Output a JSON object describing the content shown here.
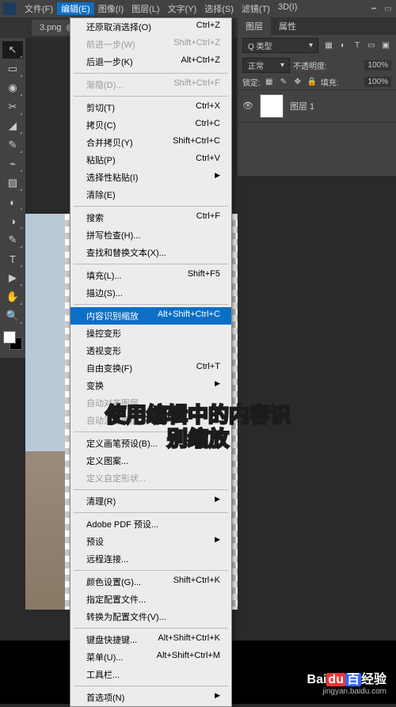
{
  "menubar": {
    "items": [
      "文件(F)",
      "编辑(E)",
      "图像(I)",
      "图层(L)",
      "文字(Y)",
      "选择(S)",
      "滤镜(T)",
      "3D(I)"
    ],
    "active_index": 1
  },
  "document_tab": {
    "title": "3.png",
    "meta": "@"
  },
  "panels": {
    "tabs": [
      "图层",
      "属性"
    ],
    "kind_label": "Q 类型",
    "blend_mode": "正常",
    "opacity_label": "不透明度:",
    "opacity_value": "100%",
    "lock_label": "锁定:",
    "fill_label": "填充:",
    "fill_value": "100%",
    "layer_name": "图层 1"
  },
  "edit_menu": [
    {
      "label": "还原取消选择(O)",
      "shortcut": "Ctrl+Z"
    },
    {
      "label": "前进一步(W)",
      "shortcut": "Shift+Ctrl+Z",
      "disabled": true
    },
    {
      "label": "后退一步(K)",
      "shortcut": "Alt+Ctrl+Z"
    },
    {
      "sep": true
    },
    {
      "label": "渐隐(D)...",
      "shortcut": "Shift+Ctrl+F",
      "disabled": true
    },
    {
      "sep": true
    },
    {
      "label": "剪切(T)",
      "shortcut": "Ctrl+X"
    },
    {
      "label": "拷贝(C)",
      "shortcut": "Ctrl+C"
    },
    {
      "label": "合并拷贝(Y)",
      "shortcut": "Shift+Ctrl+C"
    },
    {
      "label": "粘贴(P)",
      "shortcut": "Ctrl+V"
    },
    {
      "label": "选择性粘贴(I)",
      "submenu": true
    },
    {
      "label": "清除(E)"
    },
    {
      "sep": true
    },
    {
      "label": "搜索",
      "shortcut": "Ctrl+F"
    },
    {
      "label": "拼写检查(H)..."
    },
    {
      "label": "查找和替换文本(X)..."
    },
    {
      "sep": true
    },
    {
      "label": "填充(L)...",
      "shortcut": "Shift+F5"
    },
    {
      "label": "描边(S)..."
    },
    {
      "sep": true
    },
    {
      "label": "内容识别缩放",
      "shortcut": "Alt+Shift+Ctrl+C",
      "highlighted": true
    },
    {
      "label": "操控变形"
    },
    {
      "label": "透视变形"
    },
    {
      "label": "自由变换(F)",
      "shortcut": "Ctrl+T"
    },
    {
      "label": "变换",
      "submenu": true
    },
    {
      "label": "自动对齐图层...",
      "disabled": true
    },
    {
      "label": "自动混合图层...",
      "disabled": true
    },
    {
      "sep": true
    },
    {
      "label": "定义画笔预设(B)..."
    },
    {
      "label": "定义图案..."
    },
    {
      "label": "定义自定形状...",
      "disabled": true
    },
    {
      "sep": true
    },
    {
      "label": "清理(R)",
      "submenu": true
    },
    {
      "sep": true
    },
    {
      "label": "Adobe PDF 预设..."
    },
    {
      "label": "预设",
      "submenu": true
    },
    {
      "label": "远程连接..."
    },
    {
      "sep": true
    },
    {
      "label": "颜色设置(G)...",
      "shortcut": "Shift+Ctrl+K"
    },
    {
      "label": "指定配置文件..."
    },
    {
      "label": "转换为配置文件(V)..."
    },
    {
      "sep": true
    },
    {
      "label": "键盘快捷键...",
      "shortcut": "Alt+Shift+Ctrl+K"
    },
    {
      "label": "菜单(U)...",
      "shortcut": "Alt+Shift+Ctrl+M"
    },
    {
      "label": "工具栏..."
    },
    {
      "sep": true
    },
    {
      "label": "首选项(N)",
      "submenu": true
    }
  ],
  "caption": {
    "line1": "使用编辑中的内容识",
    "line2": "别缩放"
  },
  "watermark": {
    "brand_prefix": "Bai",
    "brand_mid": "百",
    "brand_suffix": "经验",
    "url": "jingyan.baidu.com"
  },
  "tools": [
    "↖",
    "▭",
    "◉",
    "✂",
    "◢",
    "✎",
    "⌁",
    "▨",
    "◐",
    "◑",
    "✎",
    "T",
    "▶",
    "✋",
    "🔍"
  ]
}
